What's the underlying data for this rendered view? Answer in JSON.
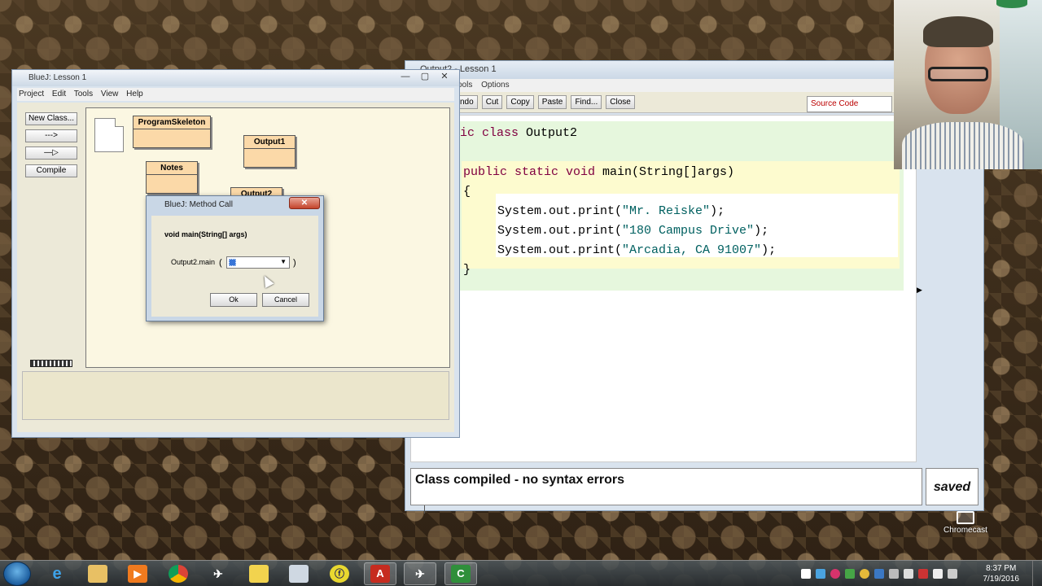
{
  "editor": {
    "title": "Output2 - Lesson 1",
    "menu": [
      "ools",
      "Options"
    ],
    "toolbar": [
      "ndo",
      "Cut",
      "Copy",
      "Paste",
      "Find...",
      "Close"
    ],
    "view_selector": "Source Code",
    "code": {
      "line1_prefix": "ic class ",
      "line1_name": "Output2",
      "line2_kw": "public static void",
      "line2_rest": " main(String[]args)",
      "line3": "{",
      "line4_pre": "System.out.print(",
      "line4_str": "\"Mr. Reiske\"",
      "line5_str": "\"180 Campus Drive\"",
      "line6_str": "\"Arcadia, CA 91007\"",
      "line_post": ");",
      "line7": "}"
    },
    "status": "Class compiled - no syntax errors",
    "saved": "saved"
  },
  "bluej": {
    "title": "BlueJ:  Lesson 1",
    "menu": [
      "Project",
      "Edit",
      "Tools",
      "View",
      "Help"
    ],
    "buttons": {
      "new_class": "New Class...",
      "dep_arrow": "--->",
      "inh_arrow": "—▷",
      "compile": "Compile"
    },
    "classes": [
      "ProgramSkeleton",
      "Output1",
      "Notes",
      "Output2"
    ]
  },
  "dialog": {
    "title": "BlueJ:  Method Call",
    "signature": "void main(String[] args)",
    "call_label": "Output2.main",
    "open_paren": "(",
    "close_paren": ")",
    "ok": "Ok",
    "cancel": "Cancel"
  },
  "desktop": {
    "chromecast": "Chromecast"
  },
  "taskbar": {
    "time": "8:37 PM",
    "date": "7/19/2016"
  }
}
